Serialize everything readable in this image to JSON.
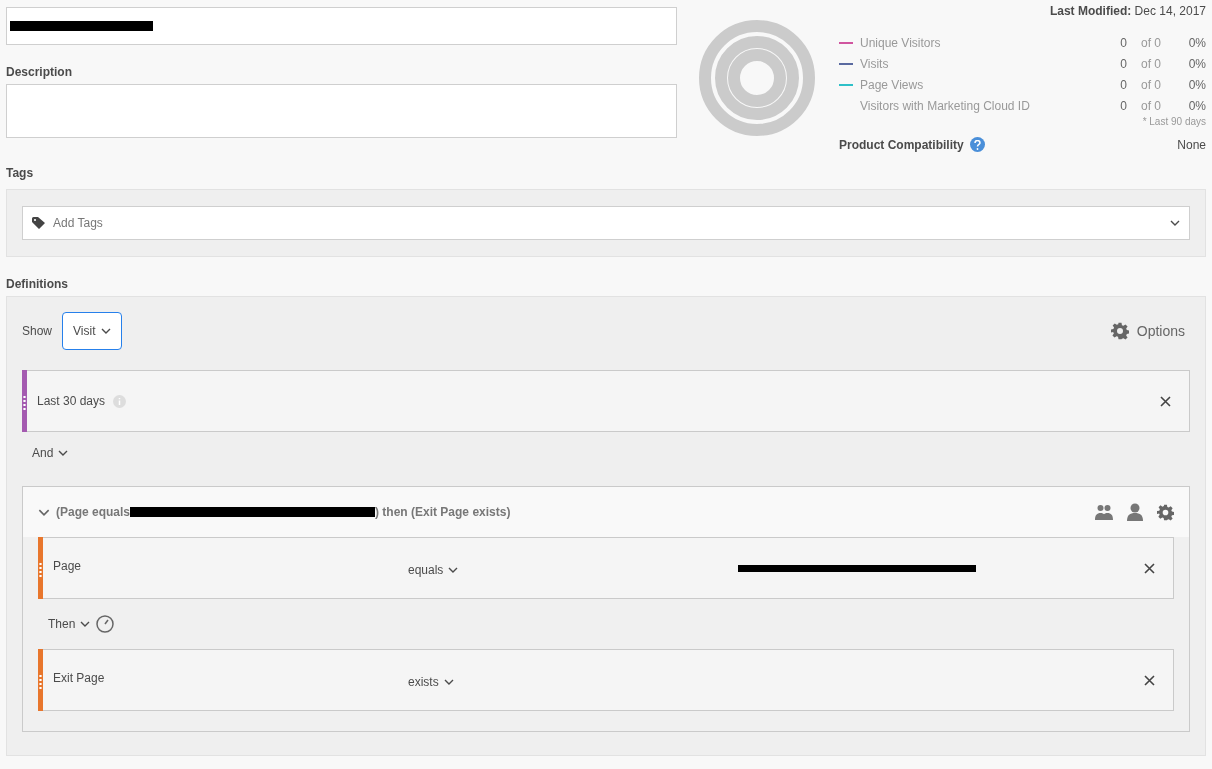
{
  "title_field": {
    "redacted": true
  },
  "description": {
    "label": "Description"
  },
  "last_modified": {
    "label": "Last Modified:",
    "value": "Dec 14, 2017"
  },
  "metrics": [
    {
      "name": "Unique Visitors",
      "color": "#d0559f",
      "count": "0",
      "of": "of 0",
      "percent": "0%"
    },
    {
      "name": "Visits",
      "color": "#5a6aa0",
      "count": "0",
      "of": "of 0",
      "percent": "0%"
    },
    {
      "name": "Page Views",
      "color": "#2ec0c8",
      "count": "0",
      "of": "of 0",
      "percent": "0%"
    },
    {
      "name": "Visitors with Marketing Cloud ID",
      "count": "0",
      "of": "of 0",
      "percent": "0%"
    }
  ],
  "footnote": "* Last 90 days",
  "product_compatibility": {
    "label": "Product Compatibility",
    "value": "None"
  },
  "tags": {
    "label": "Tags",
    "placeholder": "Add Tags"
  },
  "definitions": {
    "label": "Definitions",
    "show_label": "Show",
    "show_value": "Visit",
    "options": "Options",
    "date_rule": {
      "label": "Last 30 days",
      "color": "#a45ab0"
    },
    "operator": "And",
    "container": {
      "expanded": true,
      "summary_start": "(Page equals",
      "summary_redacted": true,
      "summary_end": ") then (Exit Page exists)",
      "sequence": "Then",
      "rules": [
        {
          "name": "Page",
          "operator": "equals",
          "value_redacted": true,
          "color": "#e8762c"
        },
        {
          "name": "Exit Page",
          "operator": "exists",
          "value_redacted": false,
          "color": "#e8762c"
        }
      ]
    }
  }
}
